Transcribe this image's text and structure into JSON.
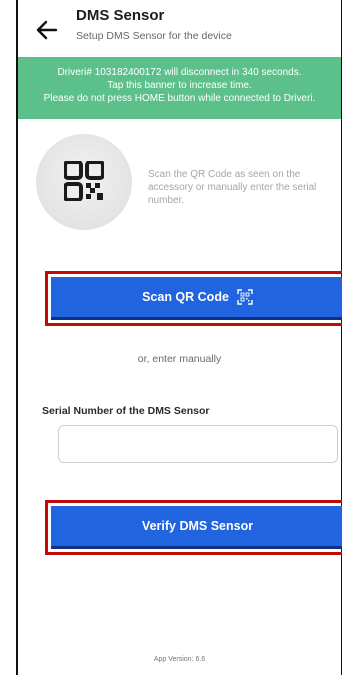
{
  "header": {
    "title": "DMS Sensor",
    "subtitle": "Setup DMS Sensor for the device"
  },
  "banner": {
    "line1": "Driveri# 103182400172 will disconnect in 340 seconds.",
    "line2": "Tap this banner to increase time.",
    "line3": "Please do not press HOME button while connected to Driveri."
  },
  "qr_section": {
    "instructions": "Scan the QR Code as seen on the accessory or manually enter the serial number."
  },
  "buttons": {
    "scan_label": "Scan QR Code",
    "verify_label": "Verify DMS Sensor"
  },
  "manual": {
    "or_text": "or, enter manually",
    "field_label": "Serial Number of the DMS Sensor",
    "field_value": "",
    "field_placeholder": ""
  },
  "footer": {
    "version": "App Version: 6.6"
  },
  "colors": {
    "banner": "#5cc08b",
    "button": "#2164e0",
    "highlight": "#c10b0b"
  },
  "icons": {
    "back": "arrow-left-icon",
    "qr": "qr-code-icon",
    "scan": "qr-scan-icon"
  }
}
